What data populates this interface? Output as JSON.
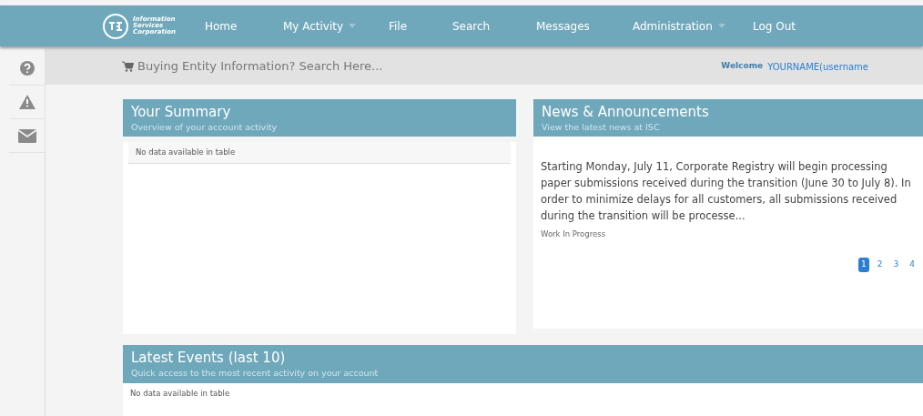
{
  "navbar": {
    "logo_text": [
      "Information",
      "Services",
      "Corporation"
    ],
    "items": [
      {
        "label": "Home",
        "dropdown": false
      },
      {
        "label": "My Activity",
        "dropdown": true
      },
      {
        "label": "File",
        "dropdown": false
      },
      {
        "label": "Search",
        "dropdown": false
      },
      {
        "label": "Messages",
        "dropdown": false
      },
      {
        "label": "Administration",
        "dropdown": true
      },
      {
        "label": "Log Out",
        "dropdown": false
      }
    ]
  },
  "sidebar": {
    "items": [
      {
        "kind": "help"
      },
      {
        "kind": "alert"
      },
      {
        "kind": "mail"
      }
    ]
  },
  "search_bar": {
    "text": "Buying Entity Information? Search Here...",
    "welcome": "Welcome",
    "user": "YOURNAME(username"
  },
  "summary": {
    "title": "Your Summary",
    "subtitle": "Overview of your account activity",
    "empty": "No data available in table"
  },
  "news": {
    "title": "News & Announcements",
    "subtitle": "View the latest news at ISC",
    "body": "Starting Monday, July 11, Corporate Registry will begin processing paper submissions received during the transition (June 30 to July 8). In order to minimize delays for all customers, all submissions received during the transition will be processe...",
    "status": "Work In Progress",
    "pages": [
      {
        "label": "1",
        "selected": true
      },
      {
        "label": "2",
        "selected": false
      },
      {
        "label": "3",
        "selected": false
      },
      {
        "label": "4",
        "selected": false
      }
    ]
  },
  "events": {
    "title": "Latest Events (last 10)",
    "subtitle": "Quick access to the most recent activity on your account",
    "empty": "No data available in table"
  }
}
